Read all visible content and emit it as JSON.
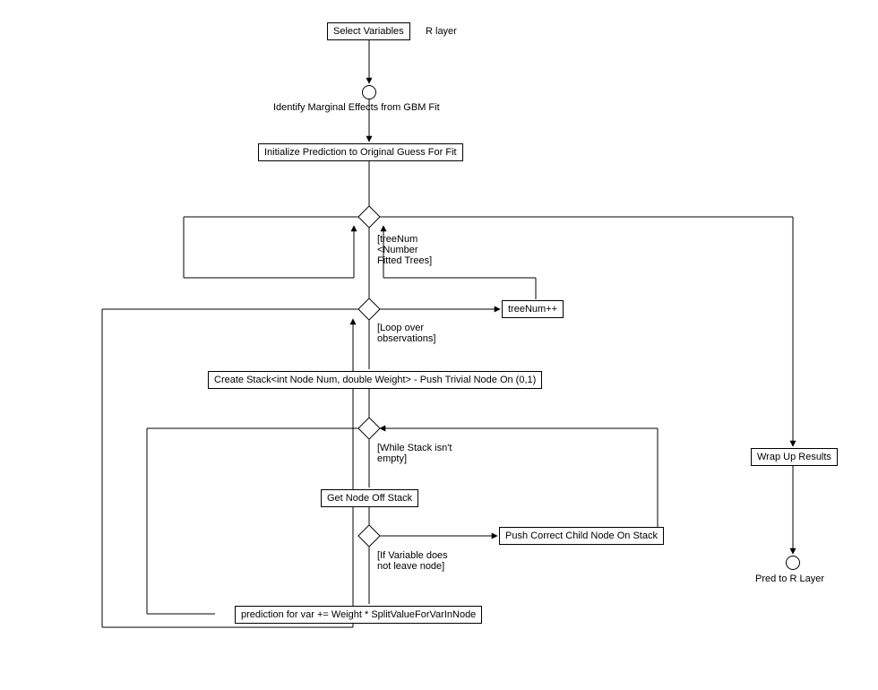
{
  "nodes": {
    "select_variables": "Select Variables",
    "r_layer": "R layer",
    "identify_marginal": "Identify Marginal Effects from GBM Fit",
    "initialize_prediction": "Initialize Prediction to Original Guess For Fit",
    "tree_num_cond": "[treeNum\n<Number\nFitted Trees]",
    "tree_num_inc": "treeNum++",
    "loop_obs": "[Loop over\nobservations]",
    "create_stack": "Create Stack<int Node Num, double Weight> - Push Trivial Node On (0,1)",
    "while_stack": "[While Stack isn't\nempty]",
    "get_node": "Get Node Off Stack",
    "if_variable": "[If Variable does\nnot leave node]",
    "push_child": "Push Correct Child Node On Stack",
    "prediction_var": "prediction for var += Weight * SplitValueForVarInNode",
    "wrap_up": "Wrap Up Results",
    "pred_layer": "Pred to R Layer"
  }
}
